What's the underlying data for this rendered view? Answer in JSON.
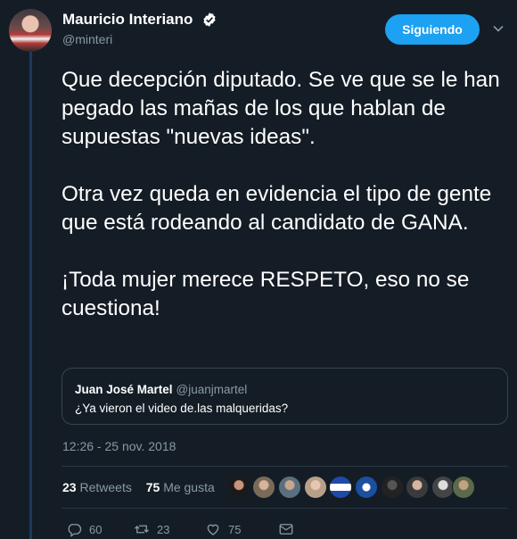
{
  "tweet": {
    "author_name": "Mauricio Interiano",
    "author_handle": "@minteri",
    "follow_label": "Siguiendo",
    "paragraphs": [
      "Que decepción diputado. Se ve que se le han pegado las mañas de los que hablan de supuestas \"nuevas ideas\".",
      "Otra vez queda en evidencia el tipo de gente que está rodeando al candidato de GANA.",
      "¡Toda mujer merece RESPETO, eso no se cuestiona!"
    ],
    "timestamp": "12:26 - 25 nov. 2018"
  },
  "quote": {
    "name": "Juan José Martel",
    "handle": "@juanjmartel",
    "text": "¿Ya vieron el video de.las malqueridas?"
  },
  "stats": {
    "retweets_count": "23",
    "retweets_label": "Retweets",
    "likes_count": "75",
    "likes_label": "Me gusta"
  },
  "actions": {
    "reply_count": "60",
    "retweet_count": "23",
    "like_count": "75"
  },
  "icons": {
    "verified": "verified-badge-icon",
    "chevron": "chevron-down-icon",
    "reply": "reply-icon",
    "retweet": "retweet-icon",
    "like": "heart-icon",
    "message": "direct-message-icon"
  },
  "colors": {
    "background": "#141d26",
    "accent": "#1da1f2",
    "muted": "#8899a6"
  }
}
